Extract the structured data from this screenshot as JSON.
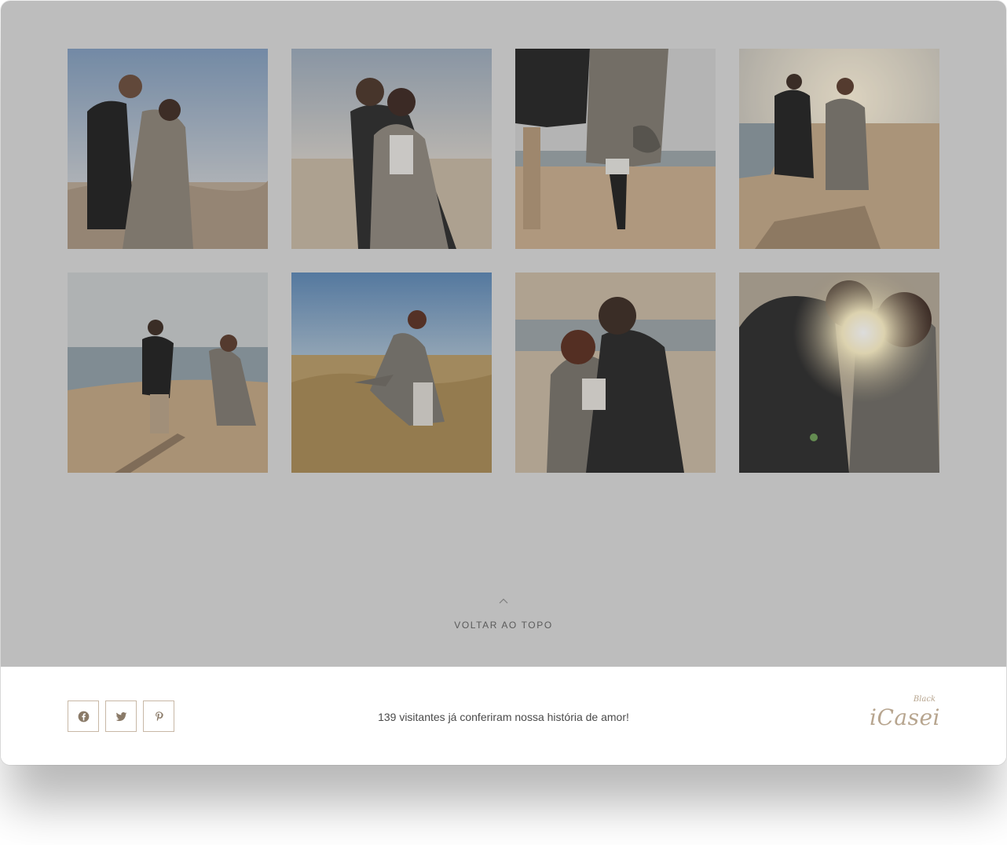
{
  "gallery": {
    "photos": [
      {
        "name": "couple-laughing-on-dunes"
      },
      {
        "name": "couple-embrace-sunglasses"
      },
      {
        "name": "couple-walking-holding-hands-closeup"
      },
      {
        "name": "couple-walking-beach-sunset"
      },
      {
        "name": "couple-playing-on-shore"
      },
      {
        "name": "woman-dancing-in-field"
      },
      {
        "name": "couple-kissing-on-beach"
      },
      {
        "name": "couple-backlit-kiss"
      }
    ]
  },
  "back_to_top": {
    "label": "VOLTAR AO TOPO",
    "icon": "chevron-up-icon"
  },
  "footer": {
    "socials": [
      {
        "icon": "facebook-icon"
      },
      {
        "icon": "twitter-icon"
      },
      {
        "icon": "pinterest-icon"
      }
    ],
    "visitors_text": "139 visitantes já conferiram nossa história de amor!",
    "brand": {
      "small": "Black",
      "main": "iCasei"
    }
  },
  "colors": {
    "gallery_bg": "#bdbdbd",
    "accent": "#b7a58f",
    "text": "#4a4a4a"
  }
}
